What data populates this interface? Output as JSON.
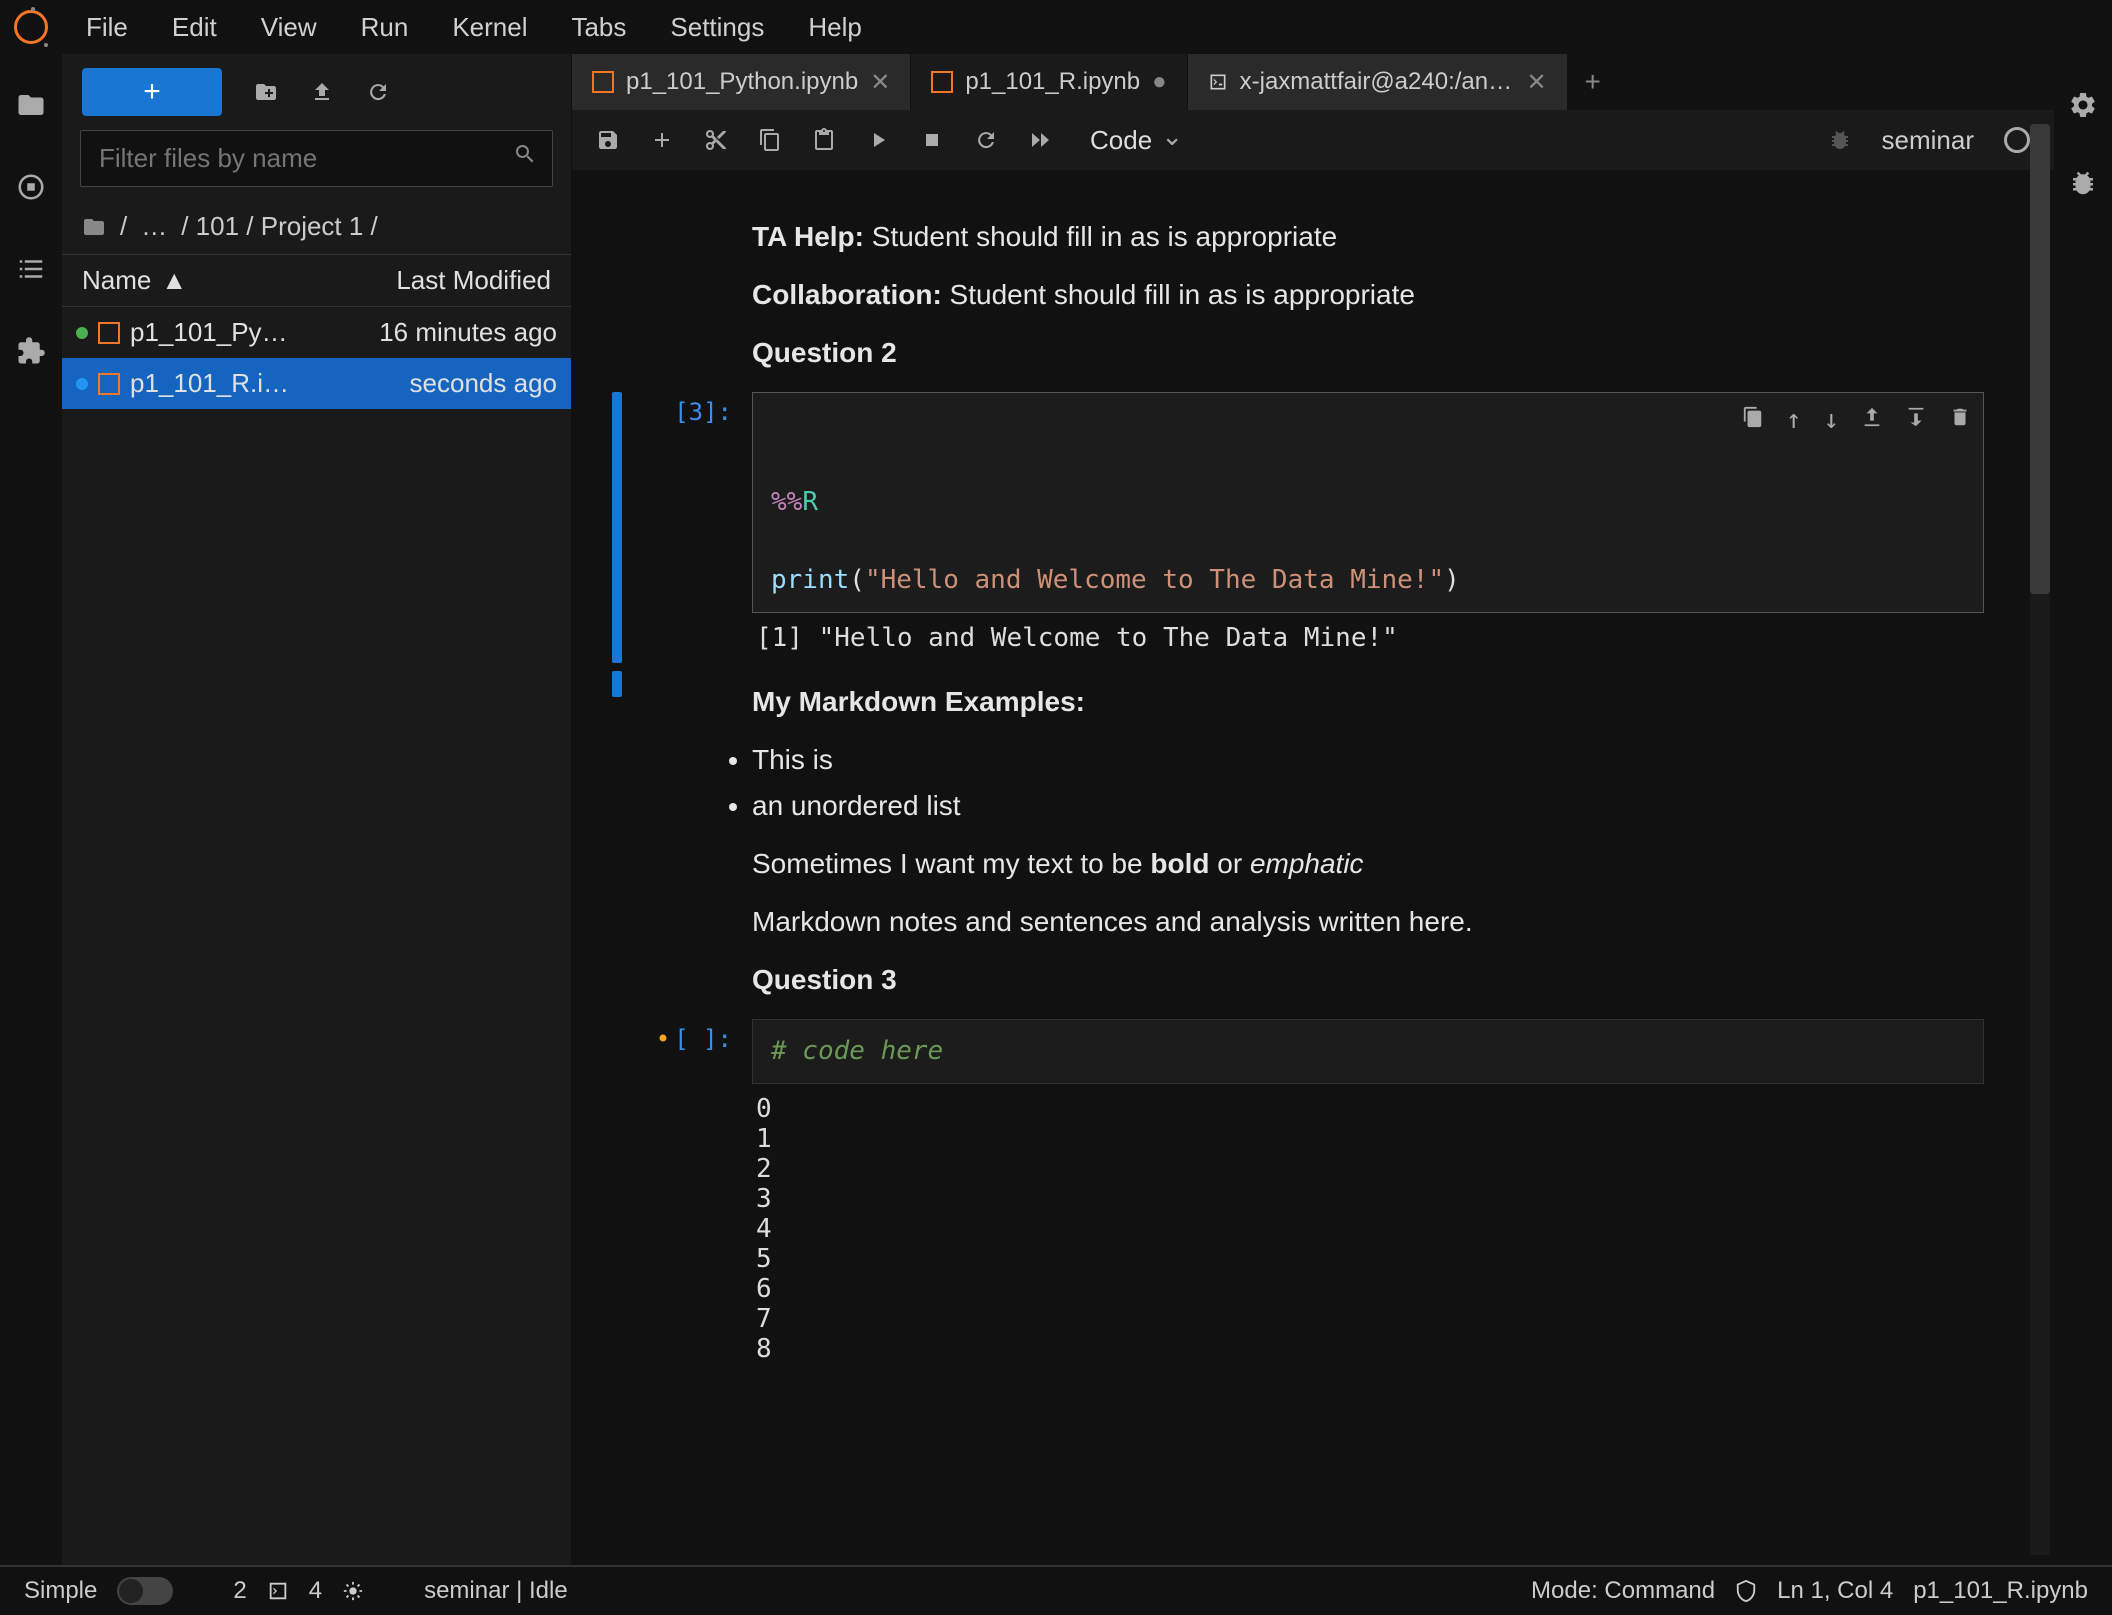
{
  "menu": [
    "File",
    "Edit",
    "View",
    "Run",
    "Kernel",
    "Tabs",
    "Settings",
    "Help"
  ],
  "filepanel": {
    "filter_placeholder": "Filter files by name",
    "breadcrumb": [
      "/",
      "…",
      "/ 101 / Project 1 /"
    ],
    "columns": {
      "name": "Name",
      "modified": "Last Modified"
    },
    "files": [
      {
        "name": "p1_101_Py…",
        "modified": "16 minutes ago",
        "status": "green",
        "selected": false
      },
      {
        "name": "p1_101_R.i…",
        "modified": "seconds ago",
        "status": "blue",
        "selected": true
      }
    ]
  },
  "tabs": [
    {
      "label": "p1_101_Python.ipynb",
      "icon": "notebook",
      "dirty": false,
      "active": false,
      "closable": true
    },
    {
      "label": "p1_101_R.ipynb",
      "icon": "notebook",
      "dirty": true,
      "active": true,
      "closable": false
    },
    {
      "label": "x-jaxmattfair@a240:/anvil/c",
      "icon": "terminal",
      "dirty": false,
      "active": false,
      "closable": true
    }
  ],
  "nb_toolbar": {
    "celltype": "Code",
    "kernel_name": "seminar"
  },
  "content": {
    "ta_label": "TA Help:",
    "ta_text": " Student should fill in as is appropriate",
    "collab_label": "Collaboration:",
    "collab_text": " Student should fill in as is appropriate",
    "q2": "Question 2",
    "cell3_prompt": "[3]:",
    "cell3_code_magic": "%%",
    "cell3_code_lang": "R",
    "cell3_code_func": "print",
    "cell3_code_paren": "(",
    "cell3_code_str": "\"Hello and Welcome to The Data Mine!\"",
    "cell3_code_close": ")",
    "cell3_output": "[1] \"Hello and Welcome to The Data Mine!\"",
    "mdex_title": "My Markdown Examples:",
    "mdex_li1": "This is",
    "mdex_li2": "an unordered list",
    "mdex_sent_pre": "Sometimes I want my text to be ",
    "mdex_bold": "bold",
    "mdex_mid": " or ",
    "mdex_em": "emphatic",
    "mdex_notes": "Markdown notes and sentences and analysis written here.",
    "q3": "Question 3",
    "cell_empty_prompt": "[ ]:",
    "cell_empty_code": "# code here",
    "cell_empty_output": "0\n1\n2\n3\n4\n5\n6\n7\n8"
  },
  "statusbar": {
    "simple": "Simple",
    "count1": "2",
    "count2": "4",
    "kernel": "seminar | Idle",
    "mode": "Mode: Command",
    "pos": "Ln 1, Col 4",
    "file": "p1_101_R.ipynb"
  }
}
